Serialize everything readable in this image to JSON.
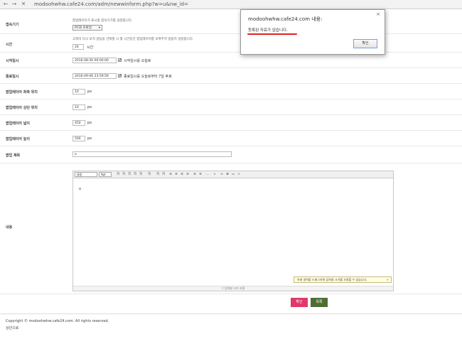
{
  "browser": {
    "back": "←",
    "forward": "→",
    "close": "✕",
    "url": "modoohwhw.cafe24.com/adm/newwinform.php?w=u&nw_id="
  },
  "form": {
    "device": {
      "label": "접속기기",
      "help": "팝업레이어가 표시될 접속기기를 설정합니다.",
      "value": "PC와 모바일"
    },
    "time": {
      "label": "시간",
      "help": "고객이 다시 보지 않음을 선택할 시 몇 시간동안 팝업레이어를 보여주지 않을지 설정합니다.",
      "value": "24",
      "unit": "시간"
    },
    "start": {
      "label": "시작일시",
      "value": "2016-08-30 00:00:00",
      "check_label": "시작일시를 오늘로"
    },
    "end": {
      "label": "종료일시",
      "value": "2016-09-06 23:59:59",
      "check_label": "종료일시를 오늘로부터 7일 후로"
    },
    "left": {
      "label": "팝업레이어 좌측 위치",
      "value": "10",
      "unit": "px"
    },
    "top": {
      "label": "팝업레이어 상단 위치",
      "value": "10",
      "unit": "px"
    },
    "width": {
      "label": "팝업레이어 넓이",
      "value": "450",
      "unit": "px"
    },
    "height": {
      "label": "팝업레이어 높이",
      "value": "500",
      "unit": "px"
    },
    "subject": {
      "label": "팝업 제목",
      "value": "o"
    },
    "content": {
      "label": "내용"
    }
  },
  "editor": {
    "font_select": "굴림",
    "size_select": "9pt",
    "toolbar_buttons": [
      "가",
      "가",
      "가",
      "가",
      "가",
      "가",
      "가",
      "가",
      "≡",
      "≡",
      "≡",
      "≡",
      "≡",
      "≡",
      "…",
      "«",
      "∞",
      "⊕",
      "▭",
      "⌕"
    ],
    "body_text": "o",
    "tip": "아래 영역을 드래그하여 입력창 크기를 조절할 수 있습니다.",
    "resize_label": "▽ 입력창 크기 조절"
  },
  "buttons": {
    "confirm": "확인",
    "list": "목록"
  },
  "colors": {
    "confirm": "#e0386b",
    "list": "#4f6e34",
    "underline": "#e02020"
  },
  "footer": {
    "copyright": "Copyright © modoohwhw.cafe24.com. All rights reserved.",
    "top_link": "상단으로"
  },
  "dialog": {
    "title": "modoohwhw.cafe24.com 내용:",
    "close": "×",
    "message": "등록된 자료가 없습니다.",
    "ok": "확인"
  }
}
